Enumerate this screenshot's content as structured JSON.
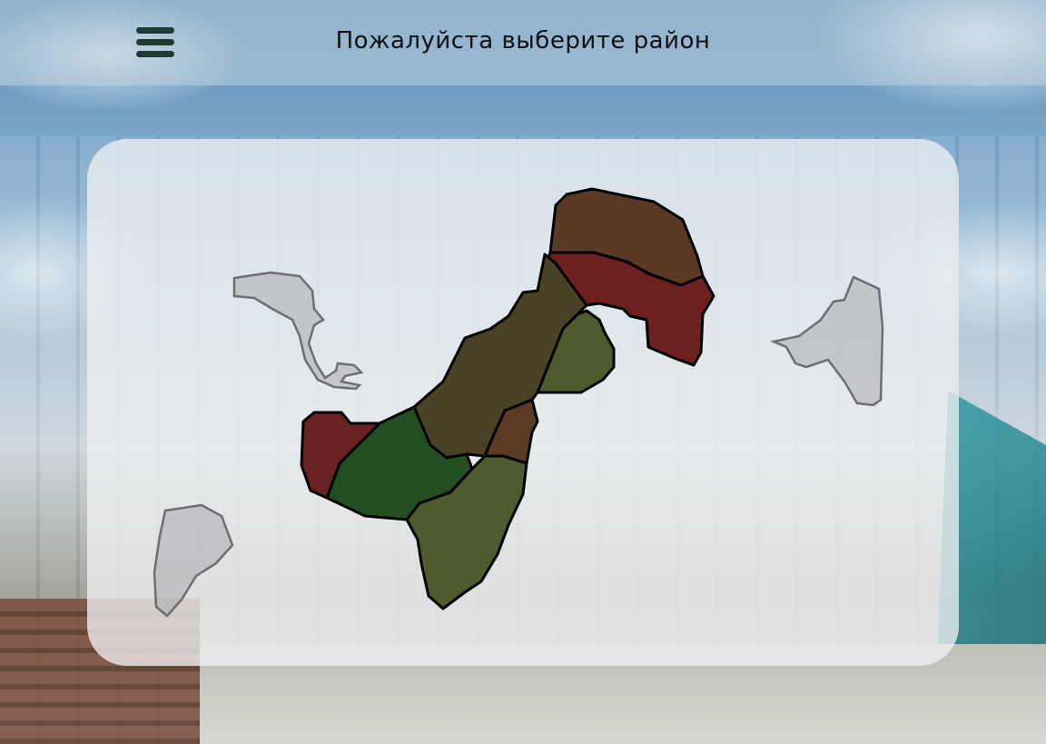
{
  "header": {
    "title": "Пожалуйста выберите район",
    "menu_icon": "hamburger-menu-icon"
  },
  "map": {
    "districts_colors": {
      "brown": "#5a3a24",
      "dark_red": "#6e1f1f",
      "olive": "#4a4226",
      "light_olive": "#4d5b2d",
      "green": "#214f22",
      "red": "#6b2222",
      "medium_brown": "#5b3b24"
    },
    "inactive_color": "#aaaaaf"
  }
}
